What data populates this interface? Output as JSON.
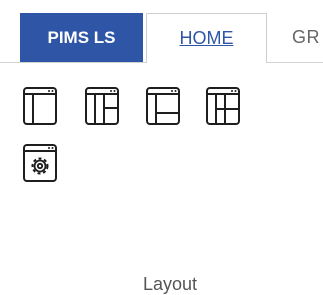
{
  "tabs": [
    {
      "label": "PIMS LS",
      "active": false
    },
    {
      "label": "HOME",
      "active": true
    },
    {
      "label": "GR",
      "active": false
    }
  ],
  "ribbon": {
    "group_label": "Layout",
    "buttons": [
      {
        "icon": "layout-single-pane-icon"
      },
      {
        "icon": "layout-three-pane-icon"
      },
      {
        "icon": "layout-side-bottom-pane-icon"
      },
      {
        "icon": "layout-quad-pane-icon"
      },
      {
        "icon": "layout-settings-icon"
      }
    ]
  },
  "colors": {
    "app_tab_bg": "#2f56a6",
    "active_tab_text": "#2f56a6",
    "icon_stroke": "#1e1e1e"
  }
}
